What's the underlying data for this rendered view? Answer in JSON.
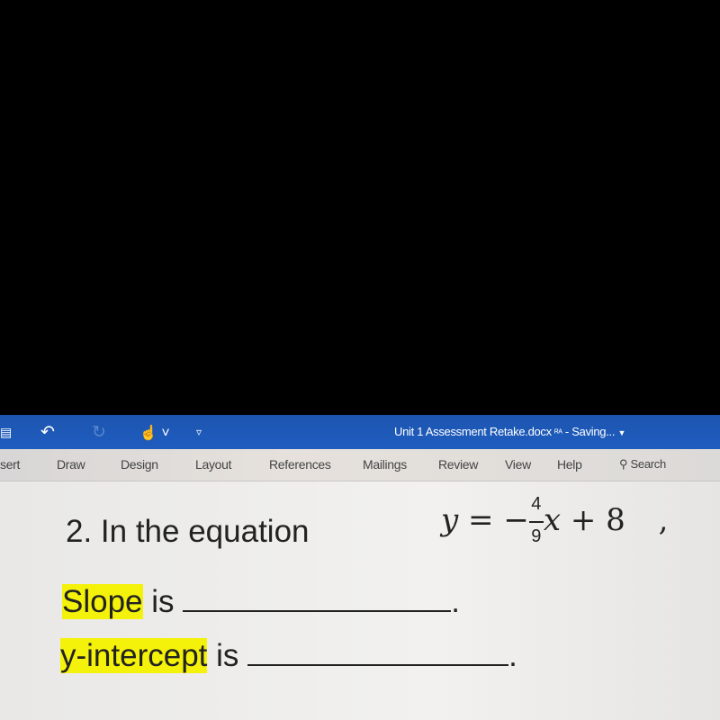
{
  "titlebar": {
    "document_title": "Unit 1 Assessment Retake.docx",
    "status": "- Saving...",
    "icons": [
      "save-icon",
      "undo-icon",
      "redo-icon",
      "touch-mode-icon",
      "customize-quick-access-icon",
      "collaborators-icon"
    ]
  },
  "ribbon": {
    "tabs": [
      "sert",
      "Draw",
      "Design",
      "Layout",
      "References",
      "Mailings",
      "Review",
      "View",
      "Help"
    ],
    "search_label": "Search"
  },
  "document": {
    "question": "2. In the equation",
    "equation": {
      "lhs": "y",
      "eq": "=",
      "sign": "−",
      "numerator": "4",
      "denominator": "9",
      "var": "x",
      "plus": "+ 8",
      "trail": ","
    },
    "slope_label": "Slope",
    "slope_is": "is",
    "period1": ".",
    "intercept_label": "y-intercept",
    "intercept_is": "is",
    "period2": "."
  }
}
